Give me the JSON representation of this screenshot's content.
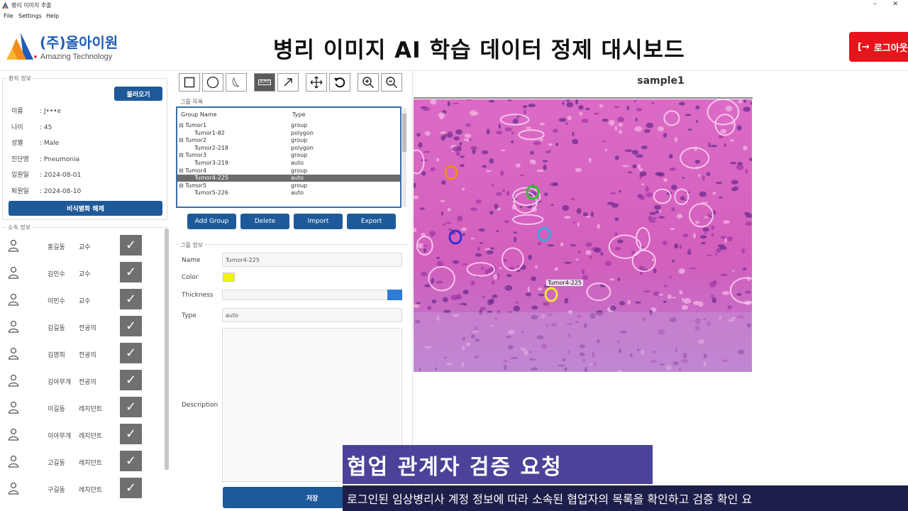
{
  "window": {
    "title": "병리 이미지 추출",
    "minimize": "–",
    "close": "✕"
  },
  "menu": [
    "File",
    "Settings",
    "Help"
  ],
  "header": {
    "company": "(주)올아이원",
    "company_sub": "Amazing Technology",
    "title": "병리 이미지 AI 학습 데이터 정제 대시보드",
    "logout_label": "로그아웃",
    "logout_icon": "logout-icon"
  },
  "patient": {
    "legend": "환자 정보",
    "load_label": "불러오기",
    "rows": [
      {
        "label": "이름",
        "value": ": J•••e"
      },
      {
        "label": "나이",
        "value": ": 45"
      },
      {
        "label": "성별",
        "value": ": Male"
      },
      {
        "label": "진단명",
        "value": ": Pneumonia"
      },
      {
        "label": "입원일",
        "value": ": 2024-08-01"
      },
      {
        "label": "퇴원일",
        "value": ": 2024-08-10"
      }
    ],
    "unmask_label": "비식별화 해제"
  },
  "affiliation": {
    "legend": "소속 정보",
    "members": [
      {
        "name": "홍길동",
        "role": "교수"
      },
      {
        "name": "김민수",
        "role": "교수"
      },
      {
        "name": "이민수",
        "role": "교수"
      },
      {
        "name": "김길동",
        "role": "전공의"
      },
      {
        "name": "김영희",
        "role": "전공의"
      },
      {
        "name": "김아무개",
        "role": "전공의"
      },
      {
        "name": "이길동",
        "role": "레지던트"
      },
      {
        "name": "이아무개",
        "role": "레지던트"
      },
      {
        "name": "고길동",
        "role": "레지던트"
      },
      {
        "name": "구길동",
        "role": "레지던트"
      }
    ],
    "check": "✓"
  },
  "toolbar": {
    "tools": [
      "rectangle-tool",
      "circle-tool",
      "freeform-tool",
      "auto-tool",
      "arrow-tool",
      "move-tool",
      "undo-tool",
      "zoom-in-tool",
      "zoom-out-tool"
    ],
    "auto_label": "AUTO"
  },
  "group_list": {
    "legend": "그룹 목록",
    "col_name": "Group Name",
    "col_type": "Type",
    "rows": [
      {
        "name": "⊟ Tumor1",
        "type": "group"
      },
      {
        "name": "Tumor1-82",
        "type": "polygon"
      },
      {
        "name": "⊟ Tumor2",
        "type": "group"
      },
      {
        "name": "Tumor2-218",
        "type": "polygon"
      },
      {
        "name": "⊟ Tumor3",
        "type": "group"
      },
      {
        "name": "Tumor3-219",
        "type": "auto"
      },
      {
        "name": "⊟ Tumor4",
        "type": "group"
      },
      {
        "name": "Tumor4-225",
        "type": "auto"
      },
      {
        "name": "⊟ Tumor5",
        "type": "group"
      },
      {
        "name": "Tumor5-226",
        "type": "auto"
      }
    ],
    "selected_row": "Tumor4-225",
    "buttons": {
      "add": "Add Group",
      "delete": "Delete",
      "import": "Import",
      "export": "Export"
    }
  },
  "group_info": {
    "legend": "그룹 정보",
    "name_label": "Name",
    "name_value": "Tumor4-225",
    "color_label": "Color",
    "color_value": "#f2f209",
    "thickness_label": "Thickness",
    "type_label": "Type",
    "type_value": "auto",
    "description_label": "Description",
    "save_label": "저장"
  },
  "viewer": {
    "title": "sample1",
    "marker_label": "Tumor4-225",
    "marker_colors": [
      "#f0892a",
      "#2ec32e",
      "#3a2fcf",
      "#3aa7e0",
      "#f2e43a"
    ]
  },
  "caption": {
    "title": "협업 관계자 검증 요청",
    "subtitle": "로그인된 임상병리사 계정 정보에 따라 소속된 협업자의 목록을 확인하고 검증 확인 요"
  }
}
